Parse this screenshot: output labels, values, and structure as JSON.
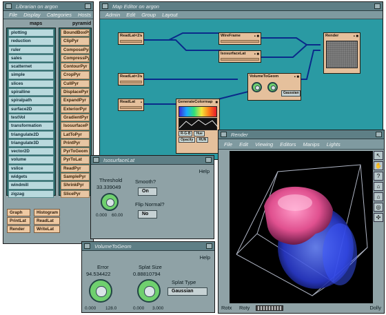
{
  "librarian": {
    "title": "Librarian on argon",
    "menu": [
      "File",
      "Display",
      "Categories",
      "Hosts"
    ],
    "col1_header": "maps",
    "col2_header": "pyramid",
    "maps_items": [
      "plotting",
      "reduction",
      "ruler",
      "sales",
      "scatternet",
      "simple",
      "slices",
      "spiralline",
      "spiralpath",
      "surface2D",
      "testVol",
      "transformation",
      "triangulate2D",
      "triangulate3D",
      "vector2D",
      "volume",
      "vslice",
      "widgets",
      "windmill",
      "zigzag"
    ],
    "pyramid_items": [
      "BoundBoxPy",
      "ClipPyr",
      "ComposePyr",
      "CompressPyr",
      "ContourPyr",
      "CropPyr",
      "CullPyr",
      "DisplacePyr",
      "ExpandPyr",
      "ExteriorPyr",
      "GradientPyr",
      "IsosurfaceP",
      "LatToPyr",
      "PrintPyr",
      "PyrToGeom",
      "PyrToLat",
      "ReadPyr",
      "SamplePyr",
      "ShrinkPyr",
      "SlicePyr"
    ],
    "buttons": [
      "Graph",
      "Histogram",
      "PrintLat",
      "ReadLat",
      "Render",
      "WriteLat"
    ]
  },
  "map_editor": {
    "title": "Map Editor on argon",
    "menu": [
      "Admin",
      "Edit",
      "Group",
      "Layout"
    ],
    "modules": {
      "readlat_a": "ReadLat<2>",
      "readlat_b": "ReadLat<3>",
      "readlat_c": "ReadLat",
      "wireframe": "WireFrame",
      "isosurface": "IsosurfaceLat",
      "volumetogeom": "VolumeToGeom",
      "volumetogeom_option": "Gaussian",
      "render": "Render",
      "colormap": "GenerateColormap",
      "colormap_rgb": "R-G-B",
      "colormap_opacity": "Opacity",
      "colormap_hue": "Hue",
      "colormap_run": "RUN"
    }
  },
  "isosurface_panel": {
    "title": "IsosurfaceLat",
    "help": "Help",
    "threshold_label": "Threshold",
    "threshold_value": "33.339049",
    "min": "0.000",
    "max": "60.00",
    "smooth_label": "Smooth?",
    "smooth_value": "On",
    "flip_label": "Flip Normal?",
    "flip_value": "No"
  },
  "volume_panel": {
    "title": "VolumeToGeom",
    "help": "Help",
    "error_label": "Error",
    "error_value": "94.534422",
    "error_min": "0.000",
    "error_max": "128.0",
    "splat_label": "Splat Size",
    "splat_value": "0.88810794",
    "splat_min": "0.000",
    "splat_max": "3.000",
    "splat_type_label": "Splat Type",
    "splat_type_value": "Gaussian"
  },
  "render": {
    "title": "Render",
    "menu": [
      "File",
      "Edit",
      "Viewing",
      "Editors",
      "Manips",
      "Lights"
    ],
    "rotx": "Rotx",
    "roty": "Roty",
    "dolly": "Dolly"
  },
  "colors": {
    "title_bg": "#5e7f86",
    "window_bg": "#8fa2a6",
    "editor_bg": "#2a9aa3",
    "wire": "#0a2a8a",
    "module": "#e5c09c",
    "dial": "#6fd06e"
  }
}
